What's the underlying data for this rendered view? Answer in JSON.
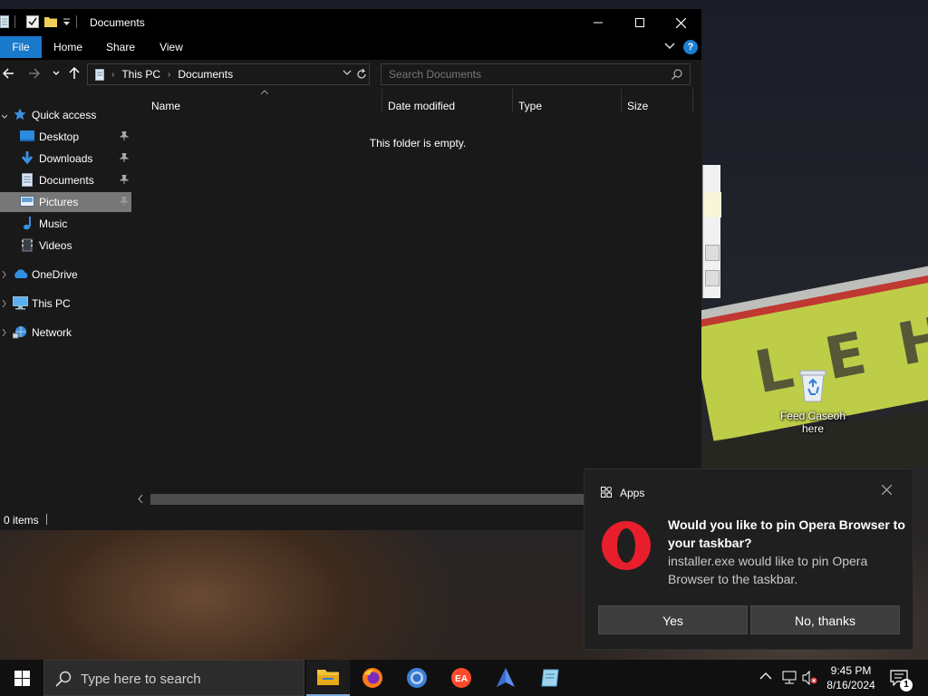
{
  "window": {
    "title": "Documents",
    "ribbon_tabs": [
      "File",
      "Home",
      "Share",
      "View"
    ],
    "help_label": "?"
  },
  "address": {
    "crumbs": [
      "This PC",
      "Documents"
    ]
  },
  "search": {
    "placeholder": "Search Documents"
  },
  "nav": {
    "items": [
      {
        "label": "Quick access",
        "icon": "star-icon",
        "level": 0
      },
      {
        "label": "Desktop",
        "icon": "desktop-folder-icon",
        "pinned": true,
        "level": 1
      },
      {
        "label": "Downloads",
        "icon": "download-arrow-icon",
        "pinned": true,
        "level": 1
      },
      {
        "label": "Documents",
        "icon": "document-icon",
        "pinned": true,
        "level": 1
      },
      {
        "label": "Pictures",
        "icon": "pictures-icon",
        "pinned": true,
        "level": 1,
        "selected": true
      },
      {
        "label": "Music",
        "icon": "music-note-icon",
        "level": 1
      },
      {
        "label": "Videos",
        "icon": "video-icon",
        "level": 1
      },
      {
        "label": "OneDrive",
        "icon": "cloud-icon",
        "level": 0
      },
      {
        "label": "This PC",
        "icon": "computer-icon",
        "level": 0
      },
      {
        "label": "Network",
        "icon": "network-icon",
        "level": 0
      }
    ]
  },
  "columns": [
    "Name",
    "Date modified",
    "Type",
    "Size"
  ],
  "content": {
    "empty_message": "This folder is empty."
  },
  "status": {
    "items_text": "0 items"
  },
  "desktop": {
    "recycle_label": "Feed Caseoh here",
    "banner_text": "LEHO"
  },
  "toast": {
    "app": "Apps",
    "title": "Would you like to pin Opera Browser to your taskbar?",
    "body": "installer.exe would like to pin Opera Browser to the taskbar.",
    "yes": "Yes",
    "no": "No, thanks"
  },
  "taskbar": {
    "search_placeholder": "Type here to search",
    "apps": [
      "file-explorer-icon",
      "firefox-icon",
      "chrome-icon",
      "ea-icon",
      "app-icon",
      "notepad-icon"
    ],
    "time": "9:45 PM",
    "date": "8/16/2024",
    "notification_count": "1"
  },
  "colors": {
    "accent": "#1979ca",
    "window_bg": "#191919",
    "selected_bg": "#777777",
    "opera_red": "#e81e2c"
  }
}
